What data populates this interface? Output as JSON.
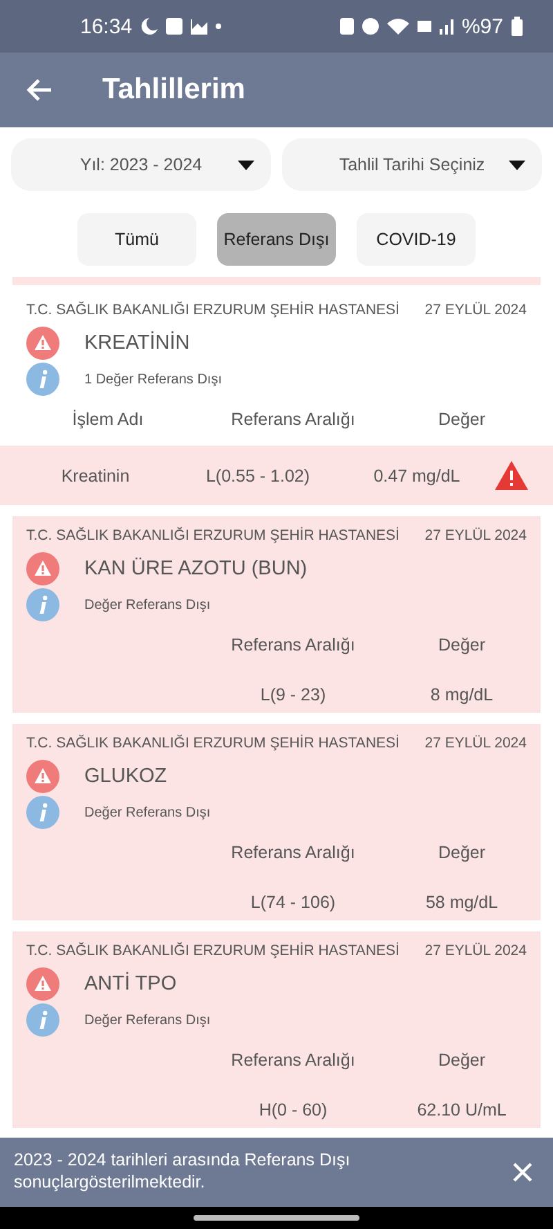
{
  "status_bar": {
    "time": "16:34",
    "battery": "%97"
  },
  "app_bar": {
    "title": "Tahlillerim"
  },
  "filters": [
    {
      "label": "Yıl: 2023 - 2024"
    },
    {
      "label": "Tahlil Tarihi Seçiniz"
    }
  ],
  "tabs": [
    {
      "label": "Tümü",
      "selected": false
    },
    {
      "label": "Referans Dışı",
      "selected": true
    },
    {
      "label": "COVID-19",
      "selected": false
    }
  ],
  "results": [
    {
      "kind": "detail",
      "hospital": "T.C. SAĞLIK BAKANLIĞI ERZURUM ŞEHİR HASTANESİ",
      "date": "27 EYLÜL 2024",
      "name": "KREATİNİN",
      "note": "1 Değer Referans Dışı",
      "columns": [
        "İşlem Adı",
        "Referans Aralığı",
        "Değer"
      ],
      "row": {
        "cells": [
          "Kreatinin",
          "L(0.55 - 1.02)",
          "0.47 mg/dL"
        ],
        "flagged": true
      }
    },
    {
      "kind": "summary",
      "hospital": "T.C. SAĞLIK BAKANLIĞI ERZURUM ŞEHİR HASTANESİ",
      "date": "27 EYLÜL 2024",
      "name": "KAN ÜRE AZOTU (BUN)",
      "note": "Değer Referans Dışı",
      "columns": [
        "Referans Aralığı",
        "Değer"
      ],
      "row": {
        "cells": [
          "L(9 - 23)",
          "8 mg/dL"
        ]
      }
    },
    {
      "kind": "summary",
      "hospital": "T.C. SAĞLIK BAKANLIĞI ERZURUM ŞEHİR HASTANESİ",
      "date": "27 EYLÜL 2024",
      "name": "GLUKOZ",
      "note": "Değer Referans Dışı",
      "columns": [
        "Referans Aralığı",
        "Değer"
      ],
      "row": {
        "cells": [
          "L(74 - 106)",
          "58 mg/dL"
        ]
      }
    },
    {
      "kind": "summary",
      "hospital": "T.C. SAĞLIK BAKANLIĞI ERZURUM ŞEHİR HASTANESİ",
      "date": "27 EYLÜL 2024",
      "name": "ANTİ TPO",
      "note": "Değer Referans Dışı",
      "columns": [
        "Referans Aralığı",
        "Değer"
      ],
      "row": {
        "cells": [
          "H(0 - 60)",
          "62.10 U/mL"
        ]
      }
    }
  ],
  "snackbar": {
    "message": "2023 - 2024 tarihleri arasında Referans Dışı sonuçlargösterilmektedir."
  }
}
